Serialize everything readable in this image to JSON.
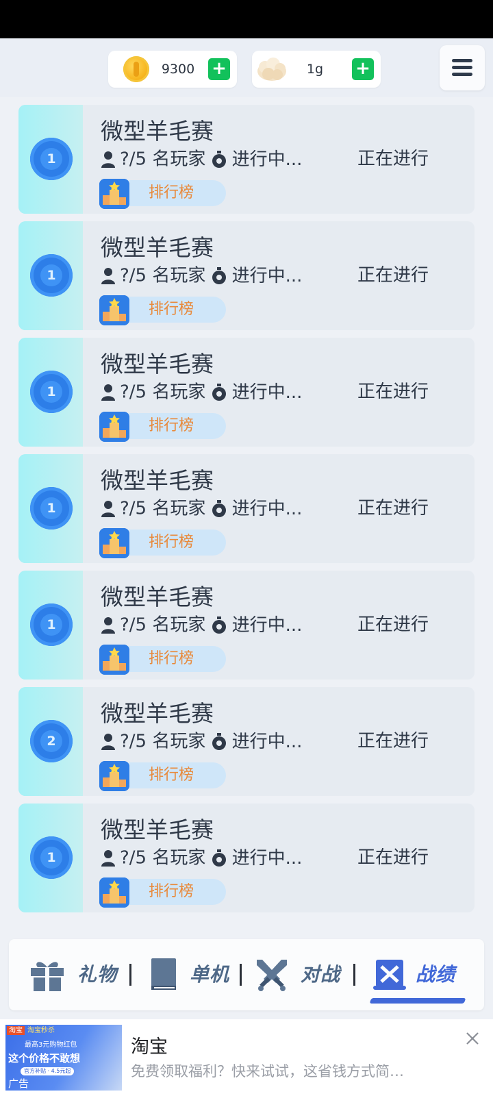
{
  "topbar": {
    "coins": {
      "value": "9300",
      "icon": "gold-coin-icon",
      "add_label": "+"
    },
    "wool": {
      "value": "1g",
      "icon": "wool-icon",
      "add_label": "+"
    },
    "menu": {
      "icon": "hamburger-menu-icon"
    }
  },
  "matches": [
    {
      "rank": "1",
      "title": "微型羊毛赛",
      "players": "?/5 名玩家",
      "status_short": "进行中...",
      "status": "正在进行",
      "rank_label": "排行榜"
    },
    {
      "rank": "1",
      "title": "微型羊毛赛",
      "players": "?/5 名玩家",
      "status_short": "进行中...",
      "status": "正在进行",
      "rank_label": "排行榜"
    },
    {
      "rank": "1",
      "title": "微型羊毛赛",
      "players": "?/5 名玩家",
      "status_short": "进行中...",
      "status": "正在进行",
      "rank_label": "排行榜"
    },
    {
      "rank": "1",
      "title": "微型羊毛赛",
      "players": "?/5 名玩家",
      "status_short": "进行中...",
      "status": "正在进行",
      "rank_label": "排行榜"
    },
    {
      "rank": "1",
      "title": "微型羊毛赛",
      "players": "?/5 名玩家",
      "status_short": "进行中...",
      "status": "正在进行",
      "rank_label": "排行榜"
    },
    {
      "rank": "2",
      "title": "微型羊毛赛",
      "players": "?/5 名玩家",
      "status_short": "进行中...",
      "status": "正在进行",
      "rank_label": "排行榜"
    },
    {
      "rank": "1",
      "title": "微型羊毛赛",
      "players": "?/5 名玩家",
      "status_short": "进行中...",
      "status": "正在进行",
      "rank_label": "排行榜"
    }
  ],
  "nav": {
    "items": [
      {
        "label": "礼物",
        "icon": "gift-icon"
      },
      {
        "label": "单机",
        "icon": "book-icon"
      },
      {
        "label": "对战",
        "icon": "crossed-swords-icon"
      },
      {
        "label": "战绩",
        "icon": "scroll-record-icon"
      }
    ],
    "active_index": 3
  },
  "ad": {
    "title": "淘宝",
    "description": "免费领取福利？快来试试，这省钱方式简…",
    "image_top_tag": "淘宝",
    "image_top_text": "淘宝秒杀",
    "image_small_text": "最高3元购物红包",
    "image_big_text": "这个价格不敢想",
    "image_pill_text": "官方补贴 · 4.5元起",
    "image_label": "广告",
    "close_icon": "close-icon"
  },
  "colors": {
    "accent": "#4168d8",
    "plus_green": "#12c15b",
    "rank_blue": "#2d7ee8",
    "rank_label_orange": "#e88a3c"
  }
}
